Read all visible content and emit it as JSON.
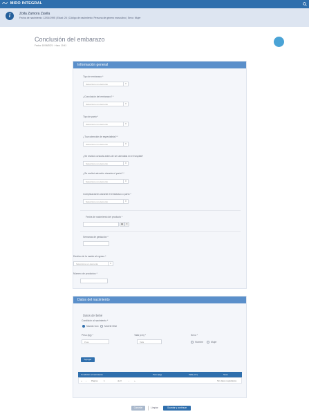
{
  "app": {
    "brand": "MIDO INTEGRAL"
  },
  "patient": {
    "name": "Zoila Zamora Zavila",
    "meta": "Fecha de nacimiento: 12/04/1995 | Edad: 26 | Código de nacimiento: Persona de género masculino | Sexo: Mujer"
  },
  "page": {
    "title": "Conclusión del embarazo",
    "subtitle": "Fecha: 10/06/2021 · Hora: 10:41"
  },
  "section1": {
    "header": "Información general",
    "fields": [
      {
        "label": "Tipo de embarazo *",
        "value": "Seleccione un elemento"
      },
      {
        "label": "¿Conclusión del embarazo? *",
        "value": "Seleccione un elemento"
      },
      {
        "label": "Tipo de parto *",
        "value": "Seleccione un elemento"
      },
      {
        "label": "¿Tuvo atención de especialista? *",
        "value": "Seleccione un elemento"
      },
      {
        "label": "¿Se realizó consulta antes de ser atendida en el hospital?",
        "value": "Seleccione un elemento"
      },
      {
        "label": "¿Se realizó atención durante el parto? *",
        "value": "Seleccione un elemento"
      },
      {
        "label": "Complicaciones durante el embarazo o parto *",
        "value": "Seleccione un elemento"
      }
    ],
    "date_label": "Fecha de nacimiento del producto *",
    "date_value": "",
    "weeks_label": "Semanas de gestación *",
    "weeks_value": "",
    "destino_label": "Destino de la madre al egreso *",
    "destino_value": "Seleccione un elemento",
    "count_label": "Número de productos *",
    "count_value": ""
  },
  "section2": {
    "header": "Datos del nacimiento",
    "sub_header": "Datos del bebé",
    "cond_label": "Condición al nacimiento *",
    "cond_options": [
      "Nacido vivo",
      "Muerte fetal"
    ],
    "peso_label": "Peso (kg) *",
    "peso_placeholder": "Peso",
    "talla_label": "Talla (cm) *",
    "talla_placeholder": "Talla",
    "sexo_label": "Sexo *",
    "sexo_options": [
      "Hombre",
      "Mujer"
    ],
    "add_button": "Agregar",
    "table": {
      "headers": [
        "Condición al nacimiento",
        "Peso (kg)",
        "Talla (cm)",
        "Sexo"
      ],
      "pager_prev": "Página",
      "pager_page": "1",
      "pager_of": "de 0",
      "pager_none": "Sin datos registrados"
    }
  },
  "footer": {
    "cancel": "Cancelar",
    "clear": "Limpiar",
    "save": "Guardar y continuar"
  },
  "colors": {
    "primary": "#2f6fad",
    "header_band": "#dde5f1",
    "card_header": "#5a8fca"
  }
}
